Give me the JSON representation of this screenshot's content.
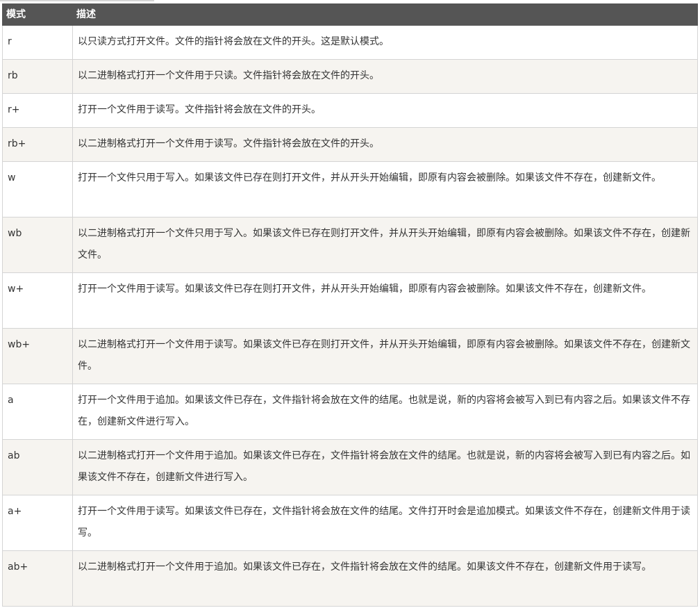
{
  "header": {
    "mode": "模式",
    "desc": "描述"
  },
  "rows": [
    {
      "mode": "r",
      "desc": "以只读方式打开文件。文件的指针将会放在文件的开头。这是默认模式。"
    },
    {
      "mode": "rb",
      "desc": "以二进制格式打开一个文件用于只读。文件指针将会放在文件的开头。"
    },
    {
      "mode": "r+",
      "desc": "打开一个文件用于读写。文件指针将会放在文件的开头。"
    },
    {
      "mode": "rb+",
      "desc": "以二进制格式打开一个文件用于读写。文件指针将会放在文件的开头。"
    },
    {
      "mode": "w",
      "desc": "打开一个文件只用于写入。如果该文件已存在则打开文件，并从开头开始编辑，即原有内容会被删除。如果该文件不存在，创建新文件。"
    },
    {
      "mode": "wb",
      "desc": "以二进制格式打开一个文件只用于写入。如果该文件已存在则打开文件，并从开头开始编辑，即原有内容会被删除。如果该文件不存在，创建新文件。"
    },
    {
      "mode": "w+",
      "desc": "打开一个文件用于读写。如果该文件已存在则打开文件，并从开头开始编辑，即原有内容会被删除。如果该文件不存在，创建新文件。"
    },
    {
      "mode": "wb+",
      "desc": "以二进制格式打开一个文件用于读写。如果该文件已存在则打开文件，并从开头开始编辑，即原有内容会被删除。如果该文件不存在，创建新文件。"
    },
    {
      "mode": "a",
      "desc": "打开一个文件用于追加。如果该文件已存在，文件指针将会放在文件的结尾。也就是说，新的内容将会被写入到已有内容之后。如果该文件不存在，创建新文件进行写入。"
    },
    {
      "mode": "ab",
      "desc": "以二进制格式打开一个文件用于追加。如果该文件已存在，文件指针将会放在文件的结尾。也就是说，新的内容将会被写入到已有内容之后。如果该文件不存在，创建新文件进行写入。"
    },
    {
      "mode": "a+",
      "desc": "打开一个文件用于读写。如果该文件已存在，文件指针将会放在文件的结尾。文件打开时会是追加模式。如果该文件不存在，创建新文件用于读写。"
    },
    {
      "mode": "ab+",
      "desc": "以二进制格式打开一个文件用于追加。如果该文件已存在，文件指针将会放在文件的结尾。如果该文件不存在，创建新文件用于读写。"
    }
  ],
  "colors": {
    "header_bg": "#555555",
    "header_text": "#ffffff",
    "row_alt_bg": "#f6f4f0",
    "border": "#d4d4d4"
  }
}
